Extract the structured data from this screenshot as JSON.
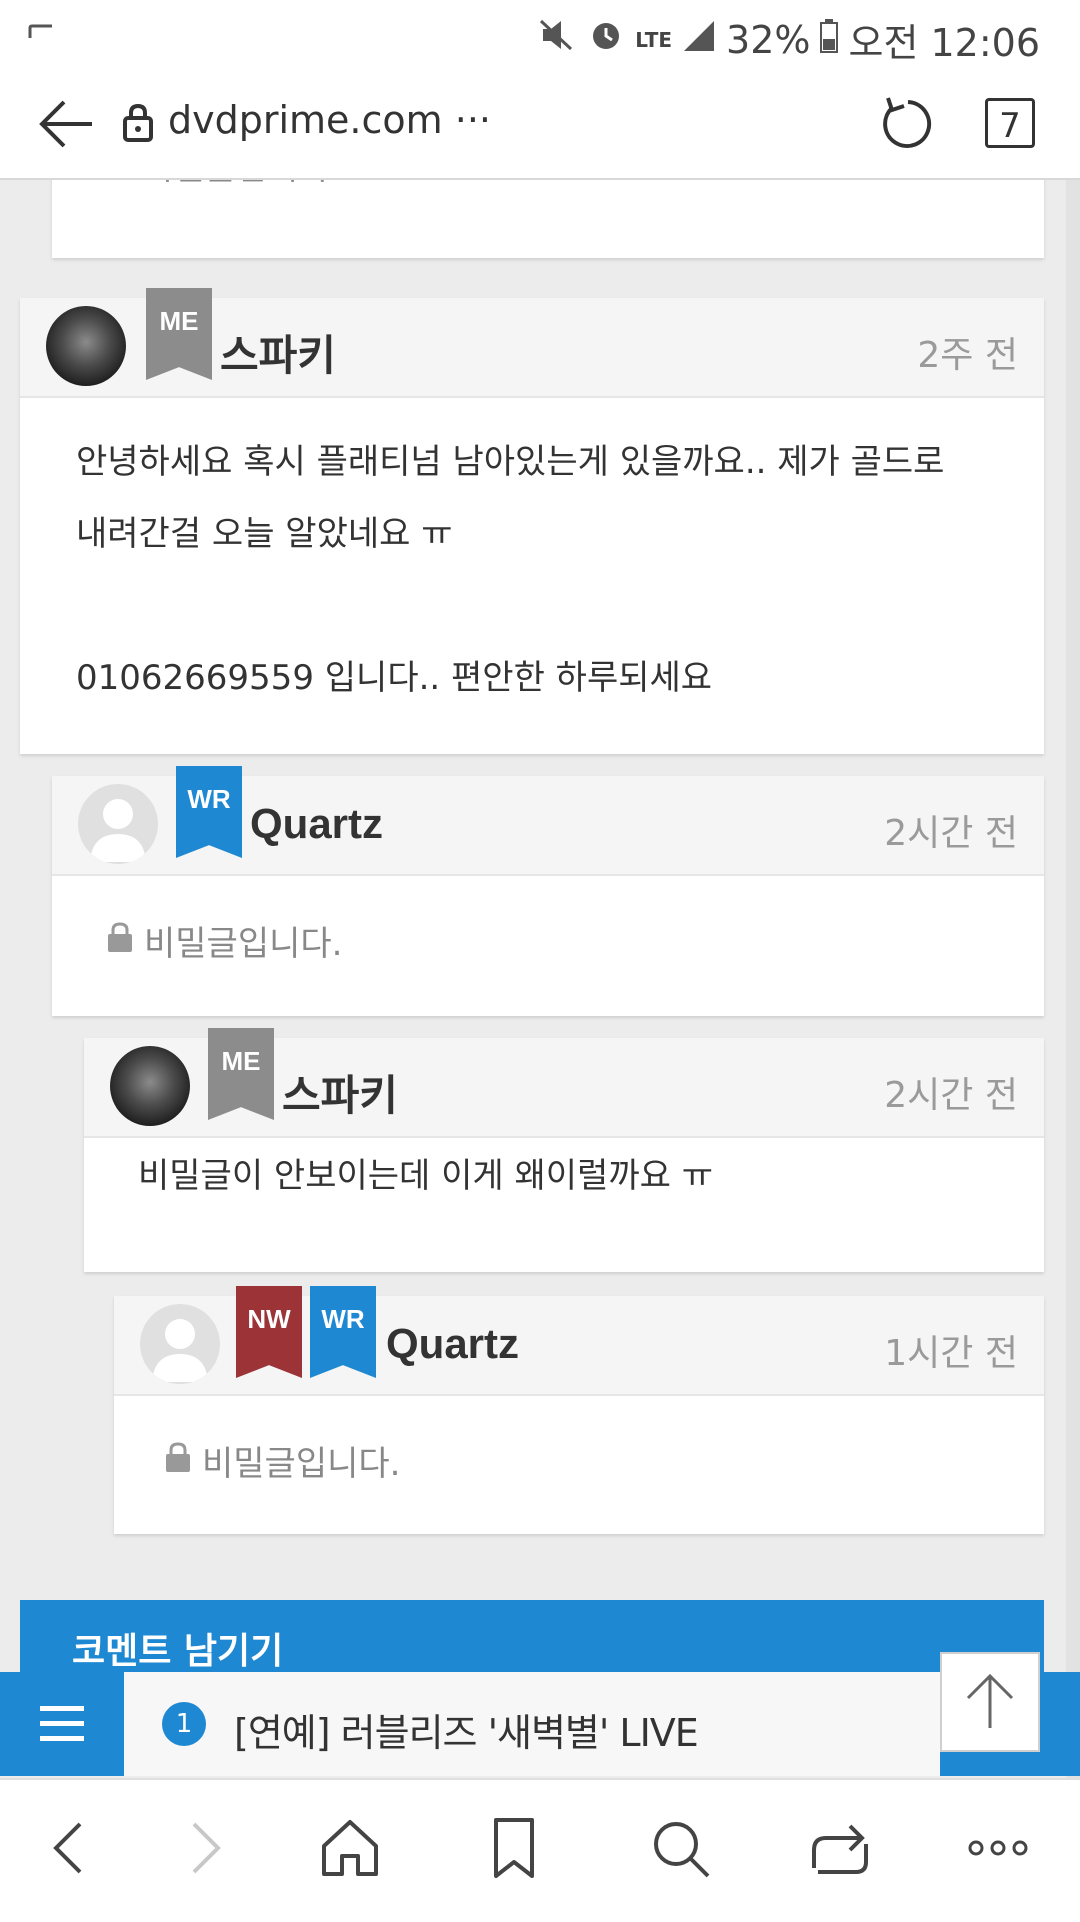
{
  "status": {
    "battery": "32%",
    "time": "오전 12:06",
    "network": "LTE"
  },
  "browser": {
    "url": "dvdprime.com ···",
    "tab_count": "7"
  },
  "comments": [
    {
      "name": "",
      "time": "",
      "secret_text": "비밀글입니다."
    },
    {
      "badges": [
        "ME"
      ],
      "name": "스파키",
      "time": "2주 전",
      "body_line1": "안녕하세요 혹시 플래티넘 남아있는게 있을까요.. 제가 골드로",
      "body_line2": "내려간걸 오늘 알았네요 ㅠ",
      "body_line3": "01062669559 입니다.. 편안한 하루되세요"
    },
    {
      "badges": [
        "WR"
      ],
      "name": "Quartz",
      "time": "2시간 전",
      "secret_text": "비밀글입니다."
    },
    {
      "badges": [
        "ME"
      ],
      "name": "스파키",
      "time": "2시간 전",
      "body_line1": "비밀글이 안보이는데 이게 왜이럴까요 ㅠ"
    },
    {
      "badges": [
        "NW",
        "WR"
      ],
      "name": "Quartz",
      "time": "1시간 전",
      "secret_text": "비밀글입니다."
    }
  ],
  "comment_box": {
    "label": "코멘트 남기기"
  },
  "ticker": {
    "number": "1",
    "text": "[연예] 러블리즈 '새벽별' LIVE"
  },
  "colors": {
    "accent": "#1f88d3",
    "me_badge": "#8c8c8c",
    "nw_badge": "#9b3337"
  }
}
